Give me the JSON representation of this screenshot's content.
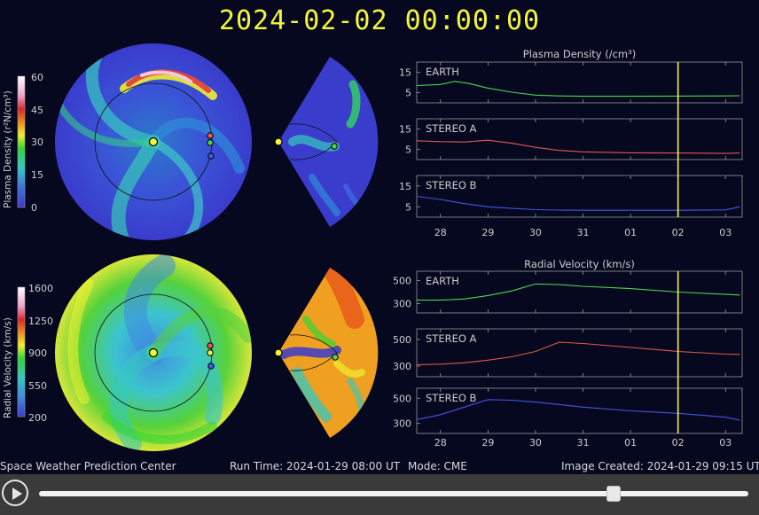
{
  "header": {
    "title": "2024-02-02  00:00:00"
  },
  "footer": {
    "org": "Space Weather Prediction Center",
    "run_time": "Run Time: 2024-01-29 08:00 UT",
    "mode": "Mode: CME",
    "created": "Image Created: 2024-01-29 09:15 UT"
  },
  "colors": {
    "title": "#f5f53a",
    "earth": "#4fd64f",
    "stereo_a": "#e35a4a",
    "stereo_b": "#4a55e0",
    "current_time": "#f5f53a"
  },
  "player": {
    "progress": 0.81,
    "play_icon": "play-icon"
  },
  "colorbars": {
    "density": {
      "label": "Plasma Density (r²N/cm³)",
      "ticks": [
        "60",
        "45",
        "30",
        "15",
        "0"
      ]
    },
    "velocity": {
      "label": "Radial Velocity (km/s)",
      "ticks": [
        "1600",
        "1250",
        "900",
        "550",
        "200"
      ]
    }
  },
  "chart_data": [
    {
      "type": "line",
      "title": "Plasma Density (/cm³)",
      "x_ticks": [
        "28",
        "29",
        "30",
        "31",
        "01",
        "02",
        "03"
      ],
      "current_time": "02",
      "panels": [
        {
          "name": "EARTH",
          "yticks": [
            "15",
            "5"
          ],
          "ylim": [
            0,
            20
          ],
          "x": [
            "27.5",
            "28.0",
            "28.3",
            "28.6",
            "29.0",
            "29.5",
            "30.0",
            "30.5",
            "31.0",
            "01.0",
            "02.0",
            "03.0",
            "03.3"
          ],
          "values": [
            8.5,
            9.0,
            10.5,
            9.5,
            7.2,
            5.2,
            3.8,
            3.4,
            3.2,
            3.2,
            3.3,
            3.4,
            3.5
          ]
        },
        {
          "name": "STEREO A",
          "yticks": [
            "15",
            "5"
          ],
          "ylim": [
            0,
            20
          ],
          "x": [
            "27.5",
            "28.0",
            "28.5",
            "29.0",
            "29.5",
            "30.0",
            "30.5",
            "31.0",
            "01.0",
            "02.0",
            "03.0",
            "03.3"
          ],
          "values": [
            9.2,
            8.8,
            8.6,
            9.5,
            8.0,
            6.0,
            4.5,
            3.8,
            3.3,
            3.2,
            3.0,
            3.2
          ]
        },
        {
          "name": "STEREO B",
          "yticks": [
            "15",
            "5"
          ],
          "ylim": [
            0,
            20
          ],
          "x": [
            "27.5",
            "28.0",
            "28.5",
            "29.0",
            "29.5",
            "30.0",
            "30.5",
            "31.0",
            "01.0",
            "02.0",
            "03.0",
            "03.3"
          ],
          "values": [
            10.0,
            8.5,
            6.5,
            5.0,
            4.2,
            3.6,
            3.4,
            3.3,
            3.3,
            3.3,
            3.5,
            5.0
          ]
        }
      ]
    },
    {
      "type": "line",
      "title": "Radial Velocity (km/s)",
      "x_ticks": [
        "28",
        "29",
        "30",
        "31",
        "01",
        "02",
        "03"
      ],
      "current_time": "02",
      "panels": [
        {
          "name": "EARTH",
          "yticks": [
            "500",
            "300"
          ],
          "ylim": [
            220,
            580
          ],
          "x": [
            "27.5",
            "28.0",
            "28.5",
            "29.0",
            "29.5",
            "30.0",
            "30.5",
            "31.0",
            "01.0",
            "02.0",
            "03.0",
            "03.3"
          ],
          "values": [
            330,
            330,
            340,
            370,
            410,
            470,
            465,
            450,
            430,
            400,
            380,
            375
          ]
        },
        {
          "name": "STEREO A",
          "yticks": [
            "500",
            "300"
          ],
          "ylim": [
            220,
            580
          ],
          "x": [
            "27.5",
            "28.0",
            "28.5",
            "29.0",
            "29.5",
            "30.0",
            "30.5",
            "31.0",
            "01.0",
            "02.0",
            "03.0",
            "03.3"
          ],
          "values": [
            310,
            315,
            325,
            345,
            370,
            410,
            480,
            470,
            440,
            410,
            390,
            388
          ]
        },
        {
          "name": "STEREO B",
          "yticks": [
            "500",
            "300"
          ],
          "ylim": [
            220,
            580
          ],
          "x": [
            "27.5",
            "28.0",
            "28.5",
            "29.0",
            "29.5",
            "30.0",
            "30.5",
            "31.0",
            "01.0",
            "02.0",
            "03.0",
            "03.3"
          ],
          "values": [
            330,
            370,
            430,
            490,
            485,
            470,
            450,
            430,
            400,
            380,
            350,
            325
          ]
        }
      ]
    }
  ]
}
